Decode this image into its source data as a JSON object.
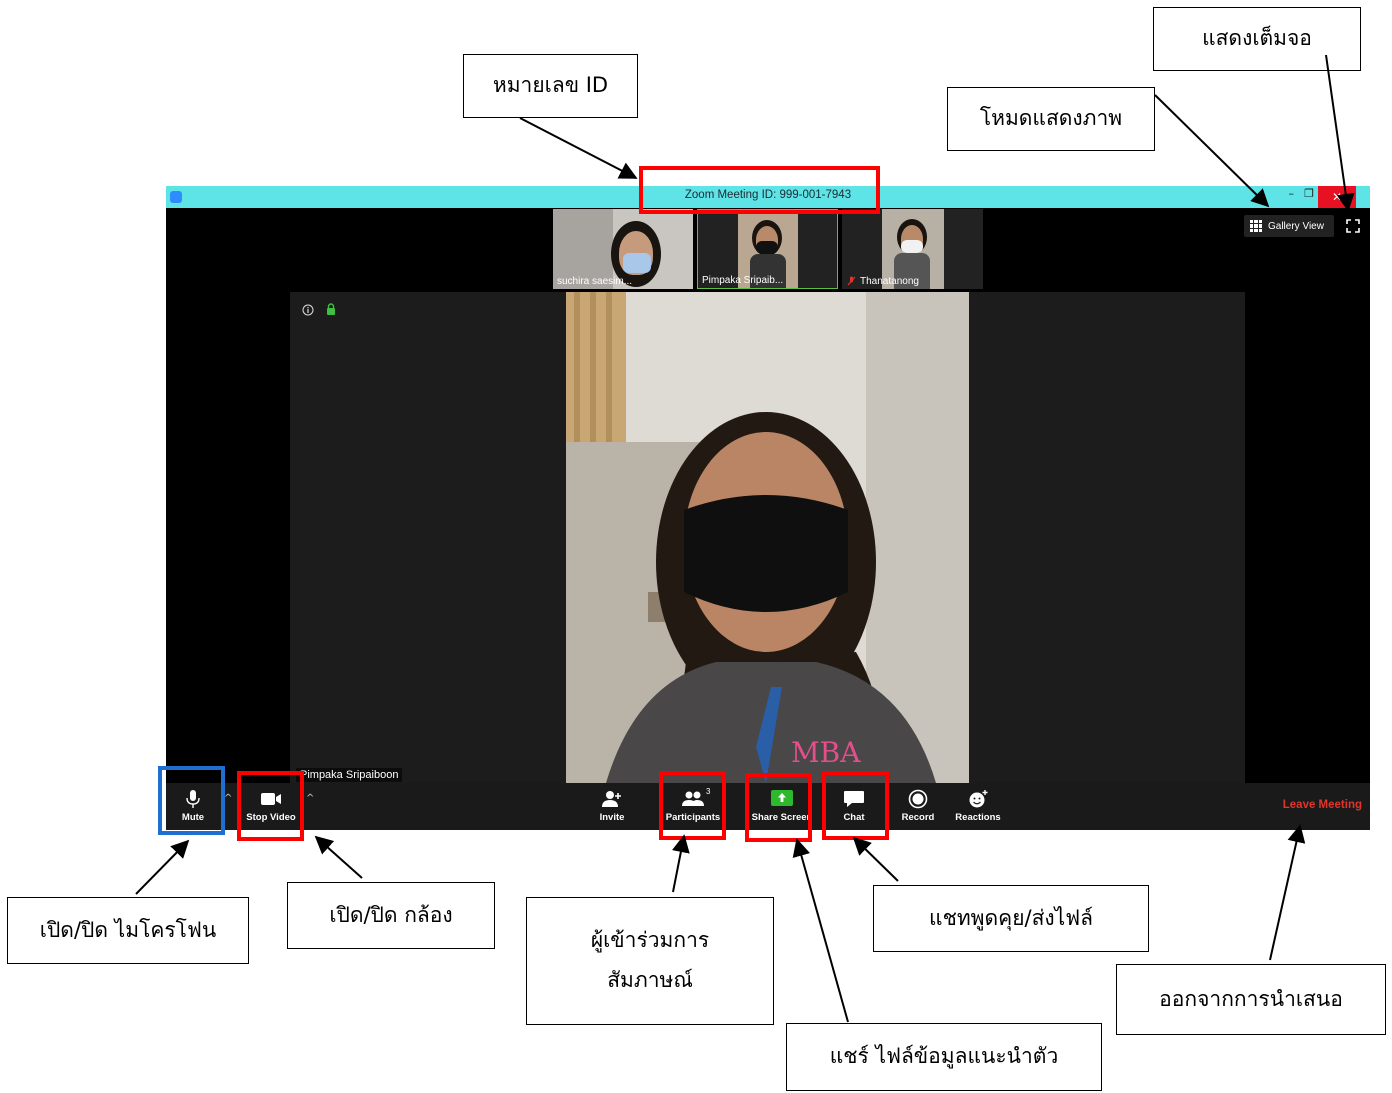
{
  "window": {
    "title": "Zoom Meeting ID: 999-001-7943",
    "minimize_glyph": "–",
    "restore_glyph": "❐",
    "close_glyph": "✕"
  },
  "view": {
    "gallery_label": "Gallery View"
  },
  "participants_strip": [
    {
      "name": "suchira saesim..."
    },
    {
      "name": "Pimpaka Sripaib..."
    },
    {
      "name": "Thanatanong"
    }
  ],
  "main": {
    "speaker_name": "Pimpaka Sripaiboon",
    "shirt_logo": "MBA"
  },
  "toolbar": {
    "mute": "Mute",
    "stop_video": "Stop Video",
    "invite": "Invite",
    "participants": "Participants",
    "participants_count": "3",
    "share_screen": "Share Screen",
    "chat": "Chat",
    "record": "Record",
    "reactions": "Reactions",
    "leave": "Leave Meeting"
  },
  "callouts": {
    "meeting_id": "หมายเลข ID",
    "fullscreen": "แสดงเต็มจอ",
    "view_mode": "โหมดแสดงภาพ",
    "mic": "เปิด/ปิด ไมโครโฟน",
    "camera": "เปิด/ปิด กล้อง",
    "participants_line1": "ผู้เข้าร่วมการ",
    "participants_line2": "สัมภาษณ์",
    "chat": "แชทพูดคุย/ส่งไฟล์",
    "leave": "ออกจากการนำเสนอ",
    "share": "แชร์ ไฟล์ข้อมูลแนะนำตัว"
  },
  "colors": {
    "titlebar": "#5ee3e6",
    "highlight_red": "#ff0000",
    "highlight_blue": "#1f6fd1",
    "share_green": "#2eb82e",
    "leave_red": "#e0352b"
  }
}
